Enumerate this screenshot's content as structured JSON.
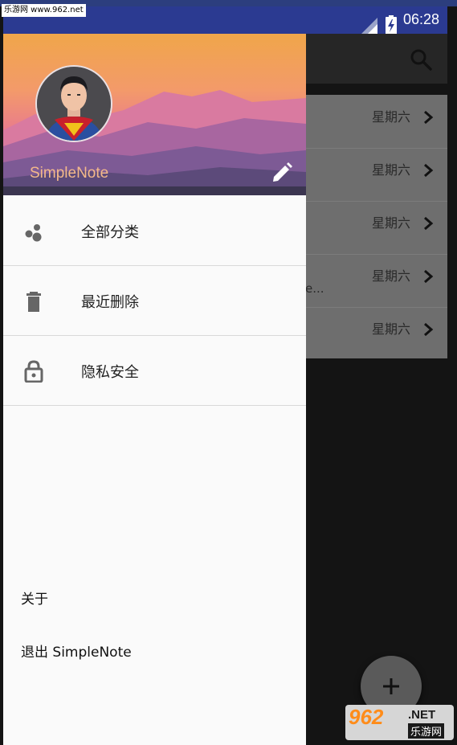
{
  "watermark": {
    "top_text": "乐游网 www.962.net",
    "logo_main": "962",
    "logo_net": ".NET",
    "logo_sub": "乐游网"
  },
  "statusbar": {
    "time": "06:28",
    "signal_icon": "cell-signal-icon",
    "battery_icon": "battery-charging-icon"
  },
  "app": {
    "toolbar": {
      "search_icon": "search-icon"
    },
    "notes": [
      {
        "date": "星期六",
        "snippet": ""
      },
      {
        "date": "星期六",
        "snippet": ""
      },
      {
        "date": "星期六",
        "snippet": ""
      },
      {
        "date": "星期六",
        "snippet": "e..."
      },
      {
        "date": "星期六",
        "snippet": ""
      }
    ],
    "fab": {
      "icon": "plus-icon"
    }
  },
  "drawer": {
    "header": {
      "username": "SimpleNote",
      "edit_icon": "pencil-icon",
      "avatar_icon": "superman-avatar"
    },
    "menu": [
      {
        "label": "全部分类",
        "icon": "category-bubbles-icon"
      },
      {
        "label": "最近删除",
        "icon": "trash-icon"
      },
      {
        "label": "隐私安全",
        "icon": "lock-icon"
      }
    ],
    "footer": {
      "about": "关于",
      "logout": "退出 SimpleNote"
    }
  },
  "colors": {
    "statusbar": "#2b3a91",
    "drawer_bg": "#fafafa",
    "username": "#f4b98a",
    "scrim_list": "#6e6e6e",
    "dark_bg": "#141414"
  }
}
